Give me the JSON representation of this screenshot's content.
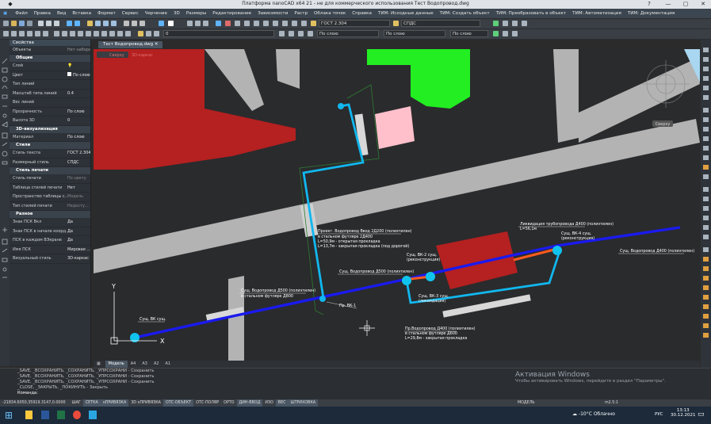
{
  "titlebar": {
    "title": "Платформа nanoCAD x64 21 - не для коммерческого использования Тест Водопровод.dwg",
    "help": "?"
  },
  "menu": [
    "Файл",
    "Правка",
    "Вид",
    "Вставка",
    "Формат",
    "Сервис",
    "Черчение",
    "3D",
    "Размеры",
    "Редактирование",
    "Зависимости",
    "Растр",
    "Облака точек",
    "Справка",
    "ТИМ: Исходные данные",
    "ТИМ: Создать объект",
    "ТИМ: Преобразовать в объект",
    "ТИМ: Автоматизация",
    "ТИМ: Документация"
  ],
  "toolbar": {
    "text_style": "ГОСТ 2.304",
    "dim_style": "СПДС",
    "layer": "0",
    "color": "По слою",
    "linetype": "По слою",
    "lineweight": "По слою"
  },
  "props": {
    "title": "Свойства",
    "filter": "Объекты",
    "filter_value": "Нет набора",
    "general": "Общие",
    "rows_general": [
      {
        "k": "Слой",
        "v": ""
      },
      {
        "k": "Цвет",
        "v": "По слою"
      },
      {
        "k": "Тип линий",
        "v": ""
      },
      {
        "k": "Масштаб типа линий",
        "v": "0.4"
      },
      {
        "k": "Вес линий",
        "v": ""
      },
      {
        "k": "Прозрачность",
        "v": "По слою"
      },
      {
        "k": "Высота 3D",
        "v": "0"
      }
    ],
    "viz": "3D-визуализация",
    "rows_viz": [
      {
        "k": "Материал",
        "v": "По слою"
      }
    ],
    "styles": "Стили",
    "rows_styles": [
      {
        "k": "Стиль текста",
        "v": "ГОСТ 2.304"
      },
      {
        "k": "Размерный стиль",
        "v": "СПДС"
      }
    ],
    "print": "Стиль печати",
    "rows_print": [
      {
        "k": "Стиль печати",
        "v": "По цвету"
      },
      {
        "k": "Таблица стилей печати",
        "v": "Нет"
      },
      {
        "k": "Пространство таблицы с...",
        "v": "Модель"
      },
      {
        "k": "Тип стилей печати",
        "v": "Недосту..."
      }
    ],
    "misc": "Разное",
    "rows_misc": [
      {
        "k": "Знак ПСК Вкл",
        "v": "Да"
      },
      {
        "k": "Знак ПСК в начале коорд...",
        "v": "Да"
      },
      {
        "k": "ПСК в каждом ВЭкране",
        "v": "Да"
      },
      {
        "k": "Имя ПСК",
        "v": "Мировая ..."
      },
      {
        "k": "Визуальный стиль",
        "v": "3D-каркас"
      }
    ]
  },
  "doc_tab": "Тест Водопровод.dwg",
  "view_labels": {
    "view": "Сверху",
    "style": "3D-каркас"
  },
  "layout_tabs": [
    "Модель",
    "A4",
    "A3",
    "A2",
    "A1"
  ],
  "compass": {
    "label": "Сверху"
  },
  "annotations": {
    "vk_exist": "Сущ. ВК сущ.",
    "pipe_exist_d500": "Сущ. Водопровод Д500 (полиэтилен)",
    "pipe_exist_d500_b": "в стальном футляре Д800",
    "pipe_new_d200": "Проект. Водопровод Ввод 2Д200 (полиэтилен)",
    "pipe_new_d200_b": "в стальном футляре 2Д400",
    "pipe_new_d200_c": "L=50,9м - открытая прокладка",
    "pipe_new_d200_d": "L=13,7м - закрытая прокладка (под дорогой)",
    "vk1": "Пр. ВК-1",
    "pipe_d500": "Сущ. Водопровод Д500 (полиэтилен)",
    "vk2": "Сущ. ВК-2 сущ.",
    "vk2_b": "(реконструкция)",
    "vk3": "Сущ. ВК-3 сущ.",
    "vk3_b": "(ликвидация)",
    "pipe_d400": "Пр.Водопровод Д400 (полиэтилен)",
    "pipe_d400_b": "в стальном футляре Д600",
    "pipe_d400_c": "L=29,8м - закрытая прокладка",
    "liquid": "Ликвидация трубопровода Д400 (полиэтилен)",
    "liquid_b": "L=56,1м",
    "vk4": "Сущ. ВК-4 сущ.",
    "vk4_b": "(реконструкция)",
    "pipe_right": "Сущ. Водопровод Д400 (полиэтилен)",
    "axis_x": "X",
    "axis_y": "Y"
  },
  "command_lines": [
    "_SAVE, _ВСОХРАНИТЬ, _СОХРАНИТЬ, _УПРСОХРАНИ - Сохранить",
    "_SAVE, _ВСОХРАНИТЬ, _СОХРАНИТЬ, _УПРСОХРАНИ - Сохранить",
    "_SAVE, _ВСОХРАНИТЬ, _СОХРАНИТЬ, _УПРСОХРАНИ - Сохранить",
    "_CLOSE, _ЗАКРЫТЬ, _ПОКИНУТЬ - Закрыть",
    "Команда:"
  ],
  "activation": {
    "title": "Активация Windows",
    "text": "Чтобы активировать Windows, перейдите в раздел \"Параметры\"."
  },
  "status": {
    "coords": "-21834.6050,35919.3147,0.0000",
    "items": [
      "ШАГ",
      "СЕТКА",
      "оПРИВЯЗКА",
      "3D оПРИВЯЗКА",
      "ОТС-ОБЪЕКТ",
      "ОТС-ПОЛЯР",
      "ОРТО",
      "ДИН-ВВОД",
      "ИЗО",
      "ВЕС",
      "ШТРИХОВКА"
    ],
    "model": "МОДЕЛЬ",
    "scale": "m2.5:1"
  },
  "taskbar": {
    "weather": "-10°C Облачно",
    "lang": "РУС",
    "time": "13:13",
    "date": "30.12.2021"
  }
}
